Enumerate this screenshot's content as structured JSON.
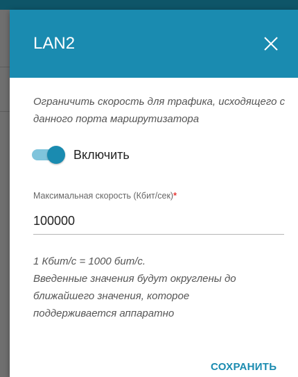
{
  "dialog": {
    "title": "LAN2",
    "description": "Ограничить скорость для трафика, исходящего с данного порта маршрутизатора",
    "toggle": {
      "label": "Включить",
      "checked": true
    },
    "field": {
      "label": "Максимальная скорость (Кбит/сек)",
      "required_mark": "*",
      "value": "100000"
    },
    "note_line1": "1 Кбит/с = 1000 бит/с.",
    "note_line2": "Введенные значения будут округлены до ближайшего значения, которое поддерживается аппаратно",
    "save_label": "СОХРАНИТЬ",
    "close_icon": "close-icon"
  },
  "colors": {
    "accent": "#1a8bb0",
    "toggle_track": "#7fc4dc",
    "required": "#e53935"
  }
}
